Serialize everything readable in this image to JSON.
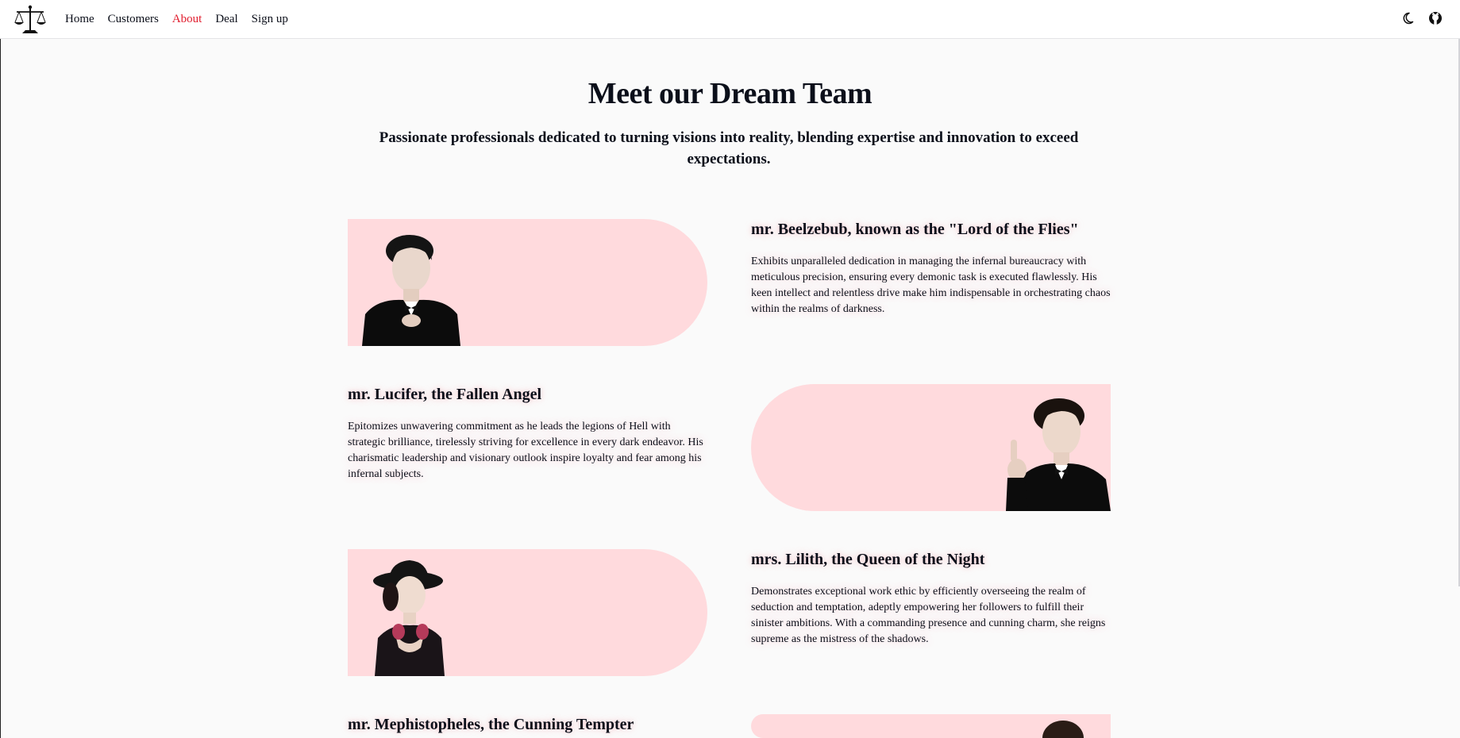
{
  "nav": {
    "items": [
      {
        "label": "Home",
        "active": false
      },
      {
        "label": "Customers",
        "active": false
      },
      {
        "label": "About",
        "active": true
      },
      {
        "label": "Deal",
        "active": false
      },
      {
        "label": "Sign up",
        "active": false
      }
    ],
    "logo_icon": "scales-of-justice-icon",
    "theme_icon": "moon-icon",
    "repo_icon": "github-icon"
  },
  "colors": {
    "accent": "#e11d2e",
    "pill": "#ffdadd",
    "text": "#0b0f1a"
  },
  "hero": {
    "title": "Meet our Dream Team",
    "subtitle": "Passionate professionals dedicated to turning visions into reality, blending expertise and innovation to exceed expectations."
  },
  "team": [
    {
      "name": "mr. Beelzebub, known as the \"Lord of the Flies\"",
      "description": "Exhibits unparalleled dedication in managing the infernal bureaucracy with meticulous precision, ensuring every demonic task is executed flawlessly. His keen intellect and relentless drive make him indispensable in orchestrating chaos within the realms of darkness."
    },
    {
      "name": "mr. Lucifer, the Fallen Angel",
      "description": "Epitomizes unwavering commitment as he leads the legions of Hell with strategic brilliance, tirelessly striving for excellence in every dark endeavor. His charismatic leadership and visionary outlook inspire loyalty and fear among his infernal subjects."
    },
    {
      "name": "mrs. Lilith, the Queen of the Night",
      "description": "Demonstrates exceptional work ethic by efficiently overseeing the realm of seduction and temptation, adeptly empowering her followers to fulfill their sinister ambitions. With a commanding presence and cunning charm, she reigns supreme as the mistress of the shadows."
    },
    {
      "name": "mr. Mephistopheles, the Cunning Tempter"
    }
  ]
}
